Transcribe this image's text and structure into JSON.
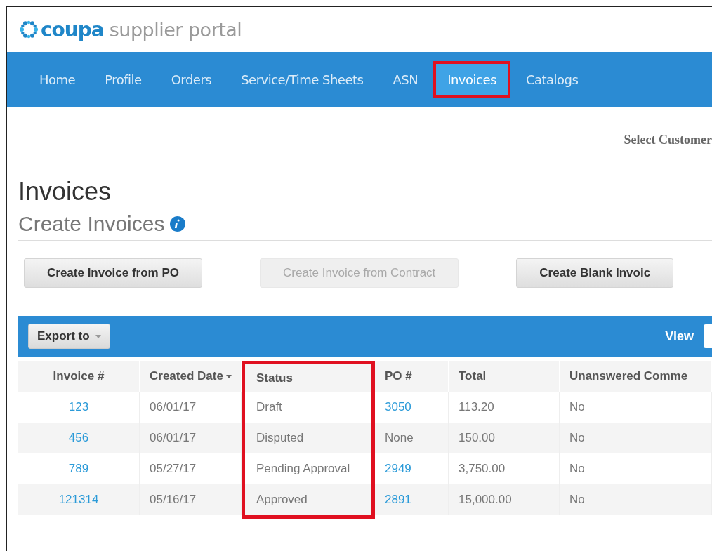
{
  "logo": {
    "brand": "coupa",
    "product": "supplier portal"
  },
  "nav": [
    {
      "label": "Home",
      "selected": false,
      "highlighted": false
    },
    {
      "label": "Profile",
      "selected": false,
      "highlighted": false
    },
    {
      "label": "Orders",
      "selected": false,
      "highlighted": false
    },
    {
      "label": "Service/Time Sheets",
      "selected": false,
      "highlighted": false
    },
    {
      "label": "ASN",
      "selected": false,
      "highlighted": false
    },
    {
      "label": "Invoices",
      "selected": true,
      "highlighted": true
    },
    {
      "label": "Catalogs",
      "selected": false,
      "highlighted": false
    }
  ],
  "select_customer": "Select Customer",
  "title": "Invoices",
  "section": {
    "title": "Create Invoices"
  },
  "buttons": [
    {
      "label": "Create Invoice from PO",
      "disabled": false
    },
    {
      "label": "Create Invoice from Contract",
      "disabled": true
    },
    {
      "label": "Create Blank Invoic",
      "disabled": false
    }
  ],
  "table": {
    "export": "Export to",
    "view": "View",
    "columns": [
      {
        "label": "Invoice #",
        "sorted": false,
        "highlighted": false
      },
      {
        "label": "Created Date",
        "sorted": true,
        "highlighted": false
      },
      {
        "label": "Status",
        "sorted": false,
        "highlighted": true
      },
      {
        "label": "PO #",
        "sorted": false,
        "highlighted": false
      },
      {
        "label": "Total",
        "sorted": false,
        "highlighted": false
      },
      {
        "label": "Unanswered Comme",
        "sorted": false,
        "highlighted": false
      }
    ],
    "rows": [
      {
        "cells": [
          "123",
          "06/01/17",
          "Draft",
          "3050",
          "113.20",
          "No"
        ],
        "links": [
          true,
          false,
          false,
          true,
          false,
          false
        ]
      },
      {
        "cells": [
          "456",
          "06/01/17",
          "Disputed",
          "None",
          "150.00",
          "No"
        ],
        "links": [
          true,
          false,
          false,
          false,
          false,
          false
        ]
      },
      {
        "cells": [
          "789",
          "05/27/17",
          "Pending Approval",
          "2949",
          "3,750.00",
          "No"
        ],
        "links": [
          true,
          false,
          false,
          true,
          false,
          false
        ]
      },
      {
        "cells": [
          "121314",
          "05/16/17",
          "Approved",
          "2891",
          "15,000.00",
          "No"
        ],
        "links": [
          true,
          false,
          false,
          true,
          false,
          false
        ]
      }
    ]
  }
}
